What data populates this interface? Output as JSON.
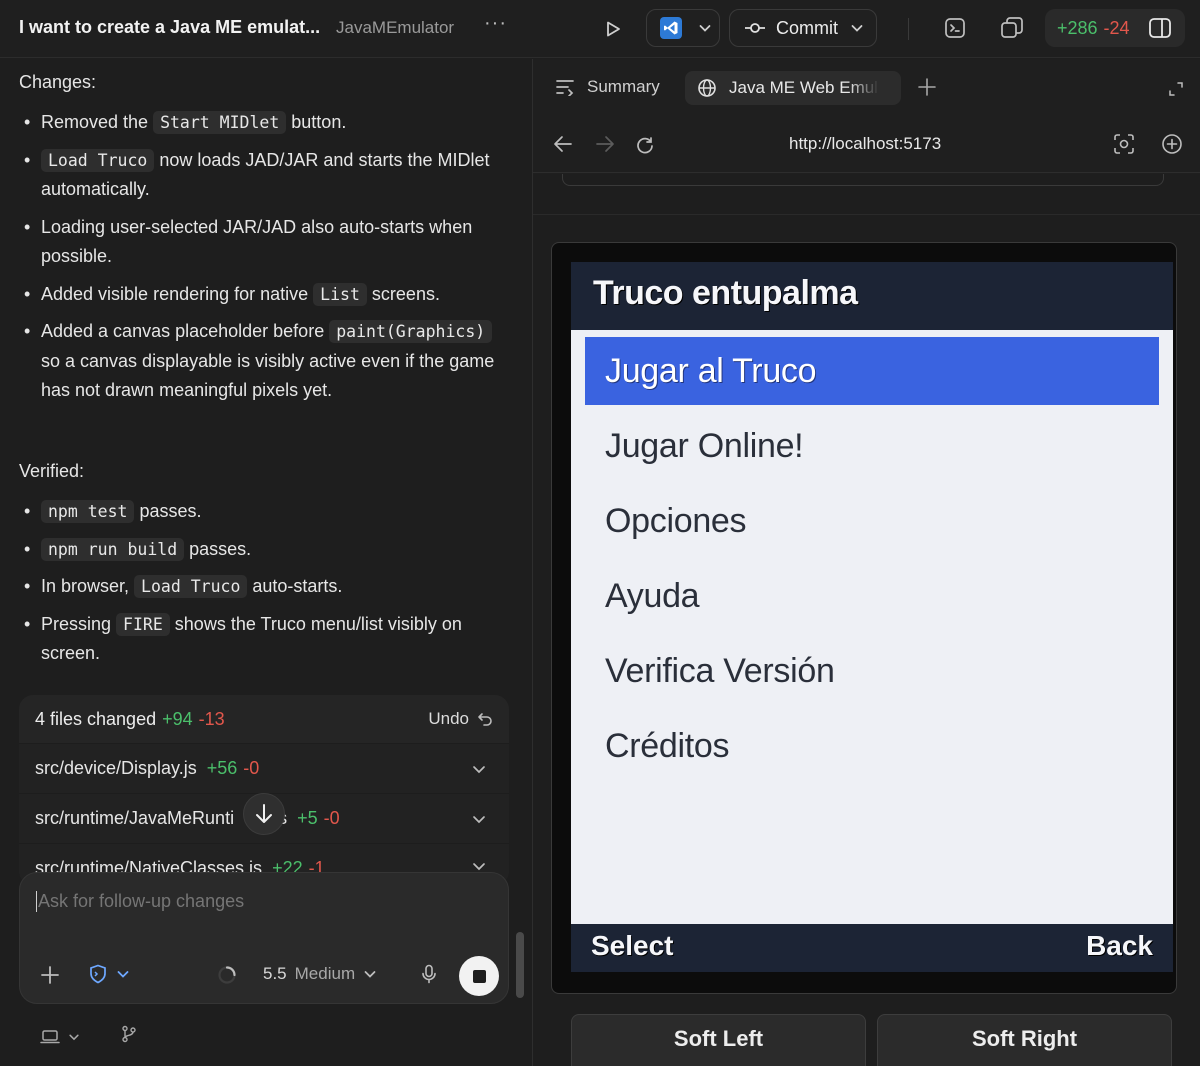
{
  "topbar": {
    "task_title": "I want to create a Java ME emulat...",
    "project_name": "JavaMEmulator",
    "commit_label": "Commit",
    "diff_added": "+286",
    "diff_removed": "-24"
  },
  "chat": {
    "changes_label": "Changes:",
    "changes": [
      {
        "pre": "Removed the ",
        "code": "Start MIDlet",
        "post": " button."
      },
      {
        "pre": "",
        "code": "Load Truco",
        "post": " now loads JAD/JAR and starts the MIDlet automatically."
      },
      {
        "pre": "Loading user-selected JAR/JAD also auto-starts when possible.",
        "code": "",
        "post": ""
      },
      {
        "pre": "Added visible rendering for native ",
        "code": "List",
        "post": " screens."
      },
      {
        "pre": "Added a canvas placeholder before ",
        "code": "paint(Graphics)",
        "post": " so a canvas displayable is visibly active even if the game has not drawn meaningful pixels yet."
      }
    ],
    "verified_label": "Verified:",
    "verified": [
      {
        "pre": "",
        "code": "npm test",
        "post": " passes."
      },
      {
        "pre": "",
        "code": "npm run build",
        "post": " passes."
      },
      {
        "pre": "In browser, ",
        "code": "Load Truco",
        "post": " auto-starts."
      },
      {
        "pre": "Pressing ",
        "code": "FIRE",
        "post": " shows the Truco menu/list visibly on screen."
      }
    ]
  },
  "files_card": {
    "summary": "4 files changed",
    "added": "+94",
    "removed": "-13",
    "undo_label": "Undo",
    "files": [
      {
        "path": "src/device/Display.js",
        "added": "+56",
        "removed": "-0"
      },
      {
        "path": "src/runtime/JavaMeRunti",
        "path_tail": "s",
        "added": "+5",
        "removed": "-0"
      },
      {
        "path": "src/runtime/NativeClasses.js",
        "added": "+22",
        "removed": "-1"
      }
    ]
  },
  "composer": {
    "placeholder": "Ask for follow-up changes",
    "model_version": "5.5",
    "model_effort": "Medium"
  },
  "browser": {
    "tab_summary": "Summary",
    "tab_active": "Java ME Web Emulator",
    "url": "http://localhost:5173"
  },
  "phone": {
    "title": "Truco entupalma",
    "menu_items": [
      "Jugar al Truco",
      "Jugar Online!",
      "Opciones",
      "Ayuda",
      "Verifica Versión",
      "Créditos"
    ],
    "selected_index": 0,
    "soft_left": "Select",
    "soft_right": "Back"
  },
  "hardware_buttons": {
    "soft_left": "Soft Left",
    "soft_right": "Soft Right"
  },
  "colors": {
    "accent_add": "#4bbf6b",
    "accent_remove": "#e2574c",
    "phone_selection": "#3a63e0",
    "phone_bar": "#1c2435"
  }
}
